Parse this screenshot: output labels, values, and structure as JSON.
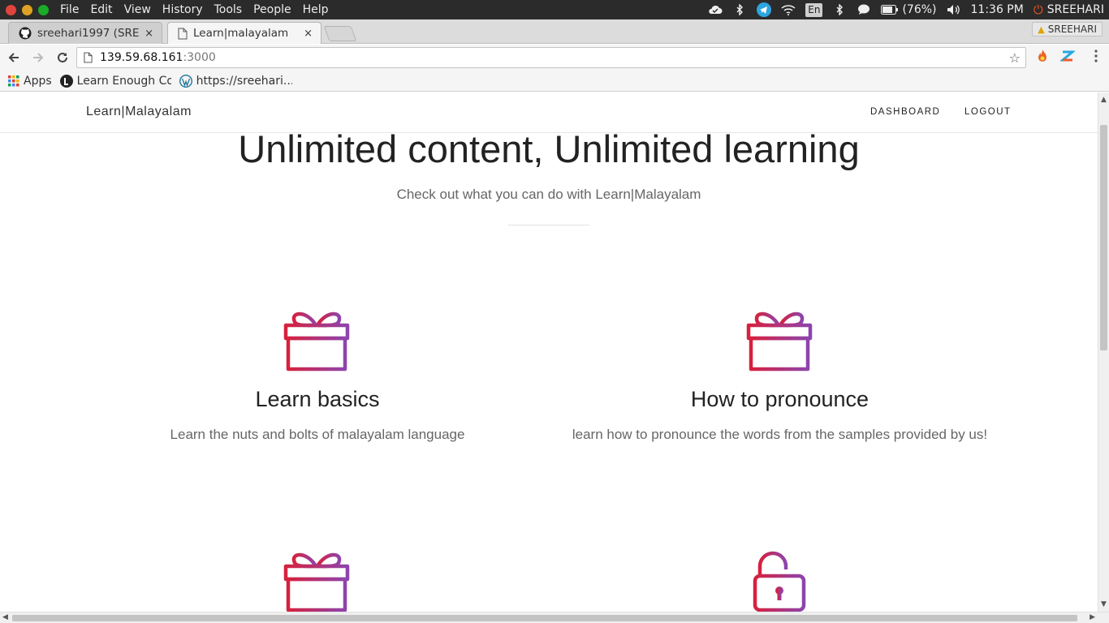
{
  "os_bar": {
    "menu": [
      "File",
      "Edit",
      "View",
      "History",
      "Tools",
      "People",
      "Help"
    ],
    "lang": "En",
    "battery": "(76%)",
    "time": "11:36 PM",
    "user": "SREEHARI"
  },
  "tabs": [
    {
      "title": "sreehari1997 (SREE",
      "close": "×"
    },
    {
      "title": "Learn|malayalam",
      "close": "×"
    }
  ],
  "profile": {
    "name": "SREEHARI"
  },
  "address_bar": {
    "host": "139.59.68.161",
    "port": ":3000"
  },
  "bookmarks": [
    {
      "label": "Apps"
    },
    {
      "label": "Learn Enough Co"
    },
    {
      "label": "https://sreehari..."
    }
  ],
  "site": {
    "brand": "Learn|Malayalam",
    "nav": [
      "DASHBOARD",
      "LOGOUT"
    ],
    "hero_title": "Unlimited content, Unlimited learning",
    "hero_subtitle": "Check out what you can do with Learn|Malayalam",
    "features": [
      {
        "icon": "gift-icon",
        "title": "Learn basics",
        "desc": "Learn the nuts and bolts of malayalam language"
      },
      {
        "icon": "gift-icon",
        "title": "How to pronounce",
        "desc": "learn how to pronounce the words from the samples provided by us!"
      },
      {
        "icon": "gift-icon",
        "title": "",
        "desc": ""
      },
      {
        "icon": "unlock-icon",
        "title": "",
        "desc": ""
      }
    ]
  },
  "colors": {
    "icon_gradient_start": "#d6213e",
    "icon_gradient_end": "#8e44ad",
    "os_bar_bg": "#2b2b2b"
  }
}
